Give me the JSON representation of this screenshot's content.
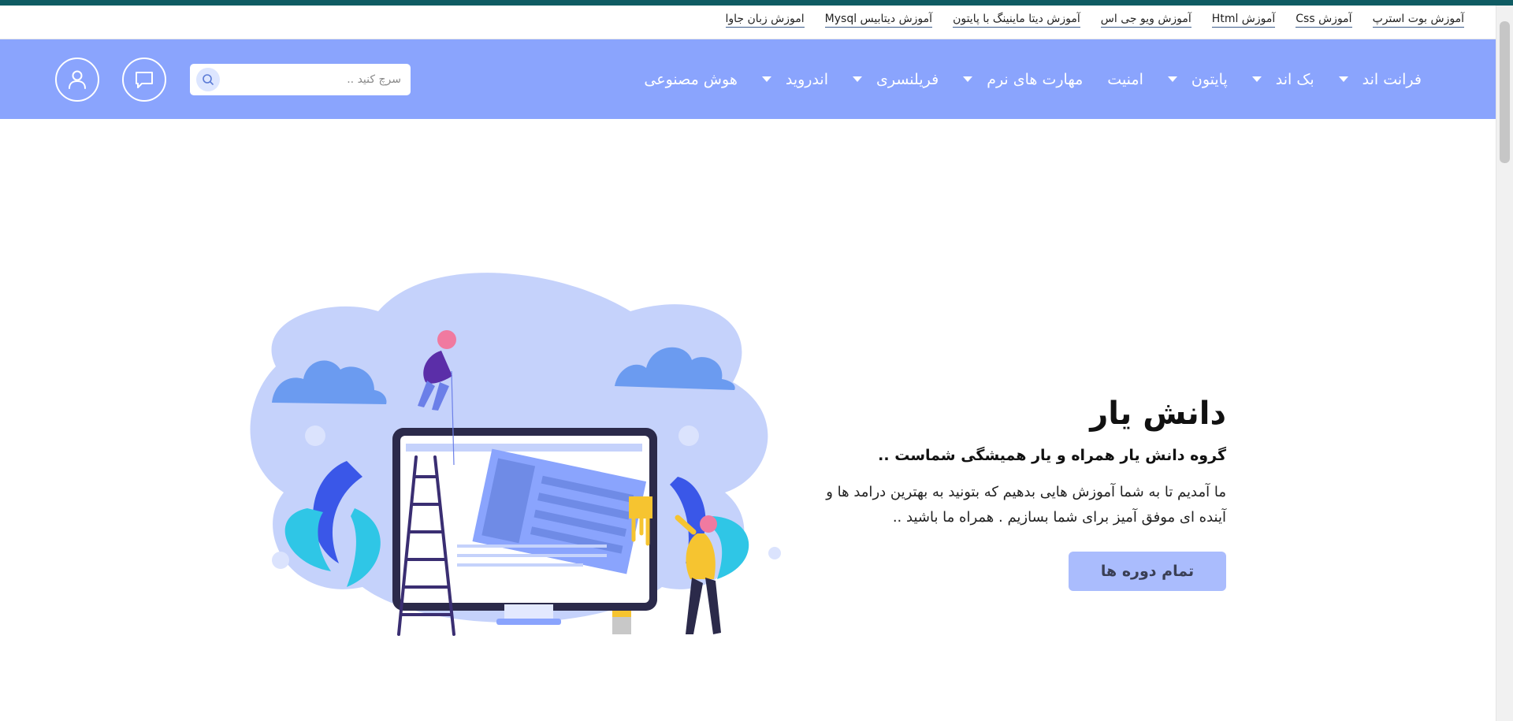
{
  "quick_links": [
    "آموزش بوت استرپ",
    "آموزش Css",
    "آموزش Html",
    "آموزش ویو جی اس",
    "آموزش دیتا ماینینگ با پایتون",
    "آموزش دیتابیس Mysql",
    "اموزش زبان جاوا"
  ],
  "nav": {
    "menu": [
      {
        "label": "فرانت اند",
        "has_dropdown": true
      },
      {
        "label": "بک اند",
        "has_dropdown": true
      },
      {
        "label": "پایتون",
        "has_dropdown": true
      },
      {
        "label": "امنیت",
        "has_dropdown": false
      },
      {
        "label": "مهارت های نرم",
        "has_dropdown": true
      },
      {
        "label": "فریلنسری",
        "has_dropdown": true
      },
      {
        "label": "اندروید",
        "has_dropdown": true
      },
      {
        "label": "هوش مصنوعی",
        "has_dropdown": false
      }
    ],
    "search_placeholder": "سرچ کنید ..",
    "bar_color": "#8aa4fd",
    "top_strip_color": "#0f5c63"
  },
  "hero": {
    "title": "دانش یار",
    "subtitle": "گروه دانش یار همراه و یار همیشگی شماست ..",
    "description": "ما آمدیم تا به شما آموزش هایی بدهیم که بتونید به بهترین درامد ها و آینده ای موفق آمیز برای شما بسازیم . همراه ما باشید ..",
    "cta_label": "تمام دوره ها",
    "cta_color": "#aabcfd"
  },
  "icons": {
    "search": "search-icon",
    "chat": "chat-icon",
    "user": "user-icon",
    "dropdown": "chevron-down-icon"
  }
}
